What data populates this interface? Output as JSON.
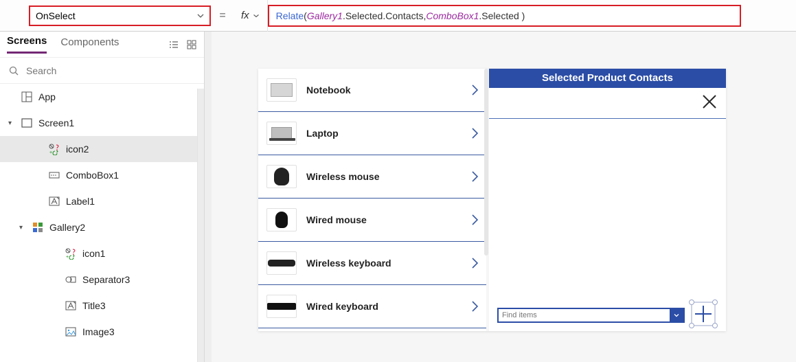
{
  "formula_bar": {
    "property_selected": "OnSelect",
    "equals": "=",
    "fx_label": "fx",
    "formula_tokens": [
      {
        "t": "func",
        "v": "Relate"
      },
      {
        "t": "plain",
        "v": "( "
      },
      {
        "t": "ident",
        "v": "Gallery1"
      },
      {
        "t": "plain",
        "v": ".Selected.Contacts, "
      },
      {
        "t": "ident",
        "v": "ComboBox1"
      },
      {
        "t": "plain",
        "v": ".Selected )"
      }
    ]
  },
  "left_panel": {
    "tabs": {
      "screens": "Screens",
      "components": "Components"
    },
    "search_placeholder": "Search",
    "tree": [
      {
        "icon": "app",
        "label": "App",
        "indent": 0,
        "caret": "",
        "sel": false
      },
      {
        "icon": "screen",
        "label": "Screen1",
        "indent": 0,
        "caret": "▾",
        "sel": false
      },
      {
        "icon": "icon-ctl",
        "label": "icon2",
        "indent": 2,
        "caret": "",
        "sel": true
      },
      {
        "icon": "combo",
        "label": "ComboBox1",
        "indent": 2,
        "caret": "",
        "sel": false
      },
      {
        "icon": "label",
        "label": "Label1",
        "indent": 2,
        "caret": "",
        "sel": false
      },
      {
        "icon": "gallery",
        "label": "Gallery2",
        "indent": 1,
        "caret": "▾",
        "sel": false
      },
      {
        "icon": "icon-ctl",
        "label": "icon1",
        "indent": 3,
        "caret": "",
        "sel": false
      },
      {
        "icon": "sep",
        "label": "Separator3",
        "indent": 3,
        "caret": "",
        "sel": false
      },
      {
        "icon": "label",
        "label": "Title3",
        "indent": 3,
        "caret": "",
        "sel": false
      },
      {
        "icon": "image",
        "label": "Image3",
        "indent": 3,
        "caret": "",
        "sel": false
      }
    ]
  },
  "canvas": {
    "gallery_items": [
      {
        "thumb": "th-notebook",
        "title": "Notebook"
      },
      {
        "thumb": "th-laptop",
        "title": "Laptop"
      },
      {
        "thumb": "th-wmouse",
        "title": "Wireless mouse"
      },
      {
        "thumb": "th-mouse",
        "title": "Wired mouse"
      },
      {
        "thumb": "th-wkb",
        "title": "Wireless keyboard"
      },
      {
        "thumb": "th-kb",
        "title": "Wired keyboard"
      }
    ],
    "contacts_header": "Selected Product Contacts",
    "combo_placeholder": "Find items"
  }
}
